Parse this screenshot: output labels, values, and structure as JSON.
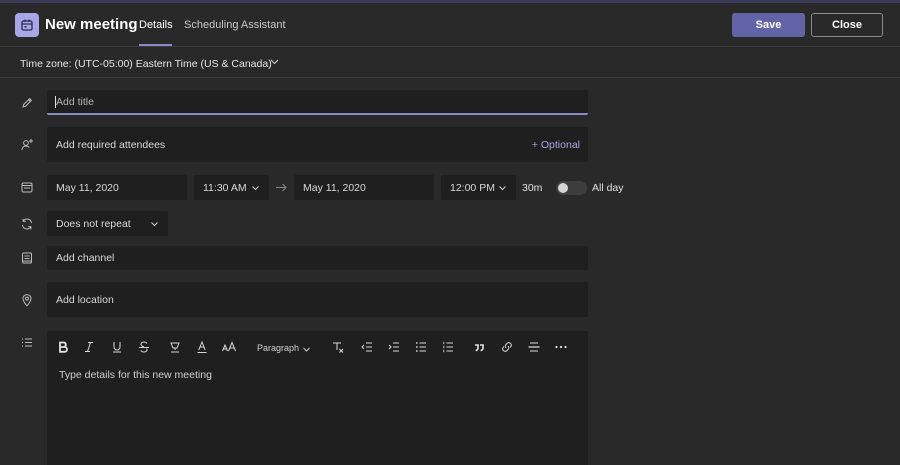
{
  "header": {
    "title": "New meeting",
    "tabs": [
      {
        "label": "Details",
        "active": true
      },
      {
        "label": "Scheduling Assistant",
        "active": false
      }
    ],
    "save_label": "Save",
    "close_label": "Close"
  },
  "timezone": {
    "label": "Time zone: (UTC-05:00) Eastern Time (US & Canada)"
  },
  "form": {
    "title_placeholder": "Add title",
    "attendees_placeholder": "Add required attendees",
    "optional_label": "+ Optional",
    "start_date": "May 11, 2020",
    "start_time": "11:30 AM",
    "end_date": "May 11, 2020",
    "end_time": "12:00 PM",
    "duration": "30m",
    "allday_label": "All day",
    "allday_on": false,
    "repeat_value": "Does not repeat",
    "channel_placeholder": "Add channel",
    "location_placeholder": "Add location"
  },
  "editor": {
    "paragraph_label": "Paragraph",
    "placeholder": "Type details for this new meeting",
    "toolbar_icons": [
      "bold-icon",
      "italic-icon",
      "underline-icon",
      "strikethrough-icon",
      "highlight-icon",
      "font-color-icon",
      "font-size-icon",
      "paragraph-style",
      "clear-formatting-icon",
      "decrease-indent-icon",
      "increase-indent-icon",
      "bulleted-list-icon",
      "numbered-list-icon",
      "quote-icon",
      "link-icon",
      "horizontal-rule-icon",
      "more-options-icon"
    ]
  },
  "colors": {
    "background": "#292929",
    "field": "#1f1f1f",
    "accent": "#6264a7",
    "accent_light": "#a9a6e8"
  }
}
